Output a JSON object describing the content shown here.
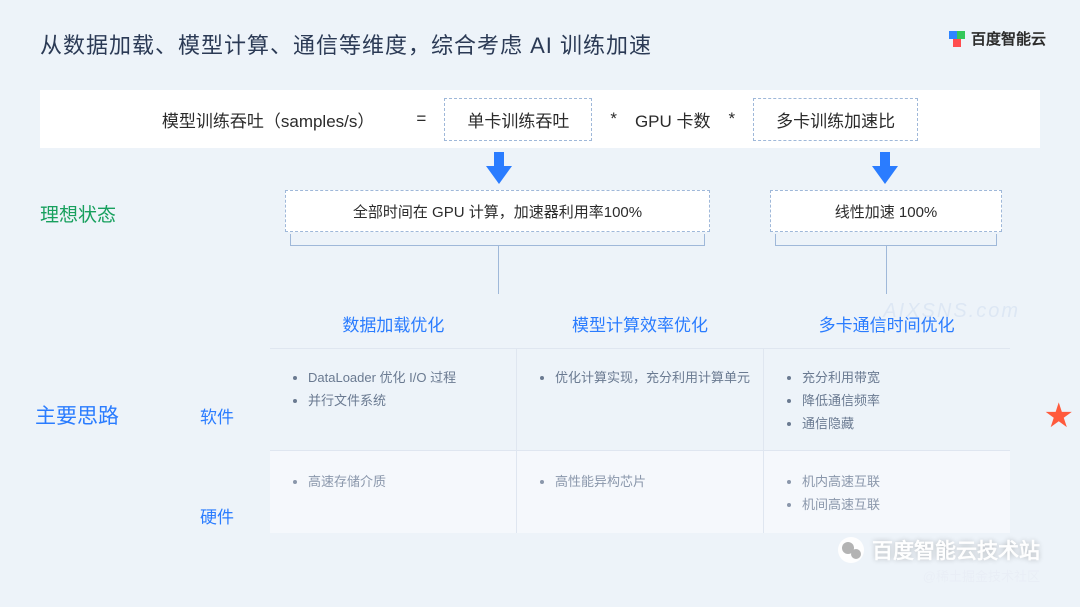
{
  "header": {
    "title": "从数据加载、模型计算、通信等维度，综合考虑 AI 训练加速",
    "brand": "百度智能云"
  },
  "formula": {
    "lhs": "模型训练吞吐（samples/s）",
    "eq": "=",
    "term1": "单卡训练吞吐",
    "op1": "*",
    "mid": "GPU 卡数",
    "op2": "*",
    "term2": "多卡训练加速比"
  },
  "ideal": {
    "label": "理想状态",
    "box1": "全部时间在 GPU 计算，加速器利用率100%",
    "box2": "线性加速 100%"
  },
  "main": {
    "label": "主要思路",
    "row_sw": "软件",
    "row_hw": "硬件",
    "cols": {
      "c1": "数据加载优化",
      "c2": "模型计算效率优化",
      "c3": "多卡通信时间优化"
    },
    "sw": {
      "c1a": "DataLoader 优化 I/O 过程",
      "c1b": "并行文件系统",
      "c2a": "优化计算实现，充分利用计算单元",
      "c3a": "充分利用带宽",
      "c3b": "降低通信频率",
      "c3c": "通信隐藏"
    },
    "hw": {
      "c1": "高速存储介质",
      "c2": "高性能异构芯片",
      "c3a": "机内高速互联",
      "c3b": "机间高速互联"
    }
  },
  "watermarks": {
    "top": "AIXSNS.com",
    "logo_text": "百度智能云技术站",
    "small": "@稀土掘金技术社区"
  }
}
